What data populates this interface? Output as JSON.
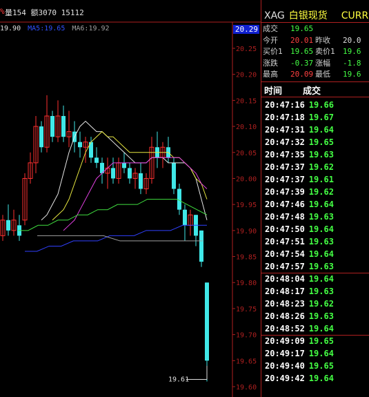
{
  "top_bar": {
    "pct_fragment": "%",
    "volume_text": "量154 额3070 15112"
  },
  "ma_line": {
    "ma1": "19.90",
    "ma2_label": "MA5:",
    "ma2": "19.65",
    "ma3_label": "MA6:",
    "ma3": "19.92"
  },
  "current_price_box": "20.29",
  "y_axis_ticks": [
    "20.25",
    "20.20",
    "20.15",
    "20.10",
    "20.05",
    "20.00",
    "19.95",
    "19.90",
    "19.85",
    "19.80",
    "19.75",
    "19.70",
    "19.65",
    "19.60"
  ],
  "low_annotation": "19.61",
  "chart_data": {
    "type": "candlestick",
    "ylim": [
      19.58,
      20.3
    ],
    "candles": [
      {
        "o": 19.89,
        "h": 19.93,
        "l": 19.88,
        "c": 19.92,
        "dir": "up"
      },
      {
        "o": 19.92,
        "h": 19.95,
        "l": 19.89,
        "c": 19.9,
        "dir": "down"
      },
      {
        "o": 19.9,
        "h": 19.94,
        "l": 19.89,
        "c": 19.92,
        "dir": "up"
      },
      {
        "o": 19.91,
        "h": 19.93,
        "l": 19.88,
        "c": 19.89,
        "dir": "down"
      },
      {
        "o": 19.92,
        "h": 20.01,
        "l": 19.91,
        "c": 20.0,
        "dir": "up"
      },
      {
        "o": 20.0,
        "h": 20.05,
        "l": 19.99,
        "c": 20.03,
        "dir": "up"
      },
      {
        "o": 20.03,
        "h": 20.12,
        "l": 20.01,
        "c": 20.1,
        "dir": "up"
      },
      {
        "o": 20.1,
        "h": 20.11,
        "l": 20.05,
        "c": 20.06,
        "dir": "down"
      },
      {
        "o": 20.06,
        "h": 20.16,
        "l": 20.05,
        "c": 20.12,
        "dir": "up"
      },
      {
        "o": 20.12,
        "h": 20.13,
        "l": 20.07,
        "c": 20.08,
        "dir": "down"
      },
      {
        "o": 20.08,
        "h": 20.15,
        "l": 20.07,
        "c": 20.12,
        "dir": "up"
      },
      {
        "o": 20.12,
        "h": 20.14,
        "l": 20.07,
        "c": 20.08,
        "dir": "down"
      },
      {
        "o": 20.08,
        "h": 20.13,
        "l": 20.06,
        "c": 20.09,
        "dir": "up"
      },
      {
        "o": 20.09,
        "h": 20.11,
        "l": 20.05,
        "c": 20.07,
        "dir": "down"
      },
      {
        "o": 20.07,
        "h": 20.09,
        "l": 20.04,
        "c": 20.06,
        "dir": "down"
      },
      {
        "o": 20.06,
        "h": 20.08,
        "l": 20.03,
        "c": 20.07,
        "dir": "up"
      },
      {
        "o": 20.07,
        "h": 20.08,
        "l": 20.03,
        "c": 20.04,
        "dir": "down"
      },
      {
        "o": 20.04,
        "h": 20.06,
        "l": 20.02,
        "c": 20.03,
        "dir": "down"
      },
      {
        "o": 20.03,
        "h": 20.04,
        "l": 19.99,
        "c": 20.01,
        "dir": "down"
      },
      {
        "o": 20.01,
        "h": 20.04,
        "l": 19.98,
        "c": 20.02,
        "dir": "up"
      },
      {
        "o": 20.02,
        "h": 20.04,
        "l": 19.99,
        "c": 20.0,
        "dir": "down"
      },
      {
        "o": 20.0,
        "h": 20.04,
        "l": 19.99,
        "c": 20.03,
        "dir": "up"
      },
      {
        "o": 20.03,
        "h": 20.05,
        "l": 20.01,
        "c": 20.02,
        "dir": "down"
      },
      {
        "o": 20.02,
        "h": 20.03,
        "l": 19.99,
        "c": 20.0,
        "dir": "down"
      },
      {
        "o": 20.0,
        "h": 20.02,
        "l": 19.98,
        "c": 20.01,
        "dir": "up"
      },
      {
        "o": 20.01,
        "h": 20.03,
        "l": 19.97,
        "c": 19.98,
        "dir": "down"
      },
      {
        "o": 19.98,
        "h": 20.01,
        "l": 19.97,
        "c": 20.0,
        "dir": "up"
      },
      {
        "o": 20.0,
        "h": 20.08,
        "l": 19.99,
        "c": 20.06,
        "dir": "up"
      },
      {
        "o": 20.06,
        "h": 20.09,
        "l": 20.02,
        "c": 20.04,
        "dir": "down"
      },
      {
        "o": 20.04,
        "h": 20.07,
        "l": 20.02,
        "c": 20.06,
        "dir": "up"
      },
      {
        "o": 20.06,
        "h": 20.08,
        "l": 20.03,
        "c": 20.04,
        "dir": "down"
      },
      {
        "o": 20.03,
        "h": 20.04,
        "l": 19.97,
        "c": 19.98,
        "dir": "down"
      },
      {
        "o": 19.98,
        "h": 19.99,
        "l": 19.93,
        "c": 19.94,
        "dir": "down"
      },
      {
        "o": 19.94,
        "h": 19.95,
        "l": 19.88,
        "c": 19.91,
        "dir": "down"
      },
      {
        "o": 19.91,
        "h": 19.94,
        "l": 19.89,
        "c": 19.93,
        "dir": "up"
      },
      {
        "o": 19.93,
        "h": 19.93,
        "l": 19.87,
        "c": 19.89,
        "dir": "down"
      },
      {
        "o": 19.9,
        "h": 19.9,
        "l": 19.83,
        "c": 19.84,
        "dir": "down"
      },
      {
        "o": 19.8,
        "h": 19.8,
        "l": 19.61,
        "c": 19.65,
        "dir": "down"
      }
    ],
    "ma_lines": [
      {
        "name": "ma-white",
        "color": "#e8e8e8",
        "points": [
          19.92,
          19.93,
          19.95,
          19.97,
          20.01,
          20.05,
          20.08,
          20.1,
          20.11,
          20.1,
          20.09,
          20.09,
          20.08,
          20.07,
          20.06,
          20.05,
          20.04,
          20.03,
          20.03,
          20.03,
          20.04,
          20.04,
          20.04,
          20.03,
          20.03,
          20.03,
          20.03,
          20.02,
          20.0,
          19.96,
          19.92
        ]
      },
      {
        "name": "ma-yellow",
        "color": "#e8e840",
        "points": [
          19.92,
          19.93,
          19.94,
          19.96,
          19.99,
          20.02,
          20.05,
          20.07,
          20.08,
          20.09,
          20.08,
          20.08,
          20.07,
          20.06,
          20.05,
          20.05,
          20.05,
          20.05,
          20.05,
          20.05,
          20.05,
          20.05,
          20.04,
          20.04,
          20.03,
          20.02,
          20.0,
          19.99,
          19.96
        ]
      },
      {
        "name": "ma-magenta",
        "color": "#e040e0",
        "points": [
          19.9,
          19.91,
          19.92,
          19.94,
          19.96,
          19.98,
          20.0,
          20.01,
          20.02,
          20.03,
          20.03,
          20.03,
          20.03,
          20.03,
          20.03,
          20.03,
          20.04,
          20.04,
          20.04,
          20.04,
          20.04,
          20.04,
          20.03,
          20.02,
          20.01,
          19.99,
          19.98
        ]
      },
      {
        "name": "ma-green",
        "color": "#40e040",
        "points": [
          19.9,
          19.9,
          19.91,
          19.91,
          19.92,
          19.92,
          19.93,
          19.93,
          19.94,
          19.94,
          19.95,
          19.95,
          19.95,
          19.96,
          19.96,
          19.96,
          19.96,
          19.95,
          19.94,
          19.93
        ]
      },
      {
        "name": "ma-blue",
        "color": "#3040ff",
        "points": [
          19.86,
          19.86,
          19.87,
          19.87,
          19.88,
          19.88,
          19.88,
          19.89,
          19.89,
          19.89,
          19.9,
          19.9,
          19.9,
          19.91,
          19.91,
          19.91
        ]
      },
      {
        "name": "ma-gray",
        "color": "#a0a0a0",
        "points": [
          19.89,
          19.89,
          19.89,
          19.89,
          19.89,
          19.88,
          19.88,
          19.88,
          19.88,
          19.88,
          19.88
        ]
      }
    ]
  },
  "quote": {
    "symbol": "XAG",
    "name": "白银现货",
    "currency": "CURR",
    "rows": [
      {
        "l1": "成交",
        "v1": "19.65",
        "c1": "green",
        "l2": "",
        "v2": "",
        "c2": "white"
      },
      {
        "l1": "今开",
        "v1": "20.01",
        "c1": "red",
        "l2": "昨收",
        "v2": "20.0",
        "c2": "white"
      },
      {
        "l1": "买价1",
        "v1": "19.65",
        "c1": "green",
        "l2": "卖价1",
        "v2": "19.6",
        "c2": "green"
      },
      {
        "l1": "涨跌",
        "v1": "-0.37",
        "c1": "green",
        "l2": "涨幅",
        "v2": "-1.8",
        "c2": "green"
      },
      {
        "l1": "最高",
        "v1": "20.09",
        "c1": "red",
        "l2": "最低",
        "v2": "19.6",
        "c2": "green"
      }
    ]
  },
  "trades": {
    "header_time": "时间",
    "header_price": "成交",
    "rows": [
      {
        "time": "20:47:16",
        "price": "19.66"
      },
      {
        "time": "20:47:18",
        "price": "19.67"
      },
      {
        "time": "20:47:31",
        "price": "19.64"
      },
      {
        "time": "20:47:32",
        "price": "19.65"
      },
      {
        "time": "20:47:35",
        "price": "19.63"
      },
      {
        "time": "20:47:37",
        "price": "19.62"
      },
      {
        "time": "20:47:37",
        "price": "19.61"
      },
      {
        "time": "20:47:39",
        "price": "19.62"
      },
      {
        "time": "20:47:46",
        "price": "19.64"
      },
      {
        "time": "20:47:48",
        "price": "19.63"
      },
      {
        "time": "20:47:50",
        "price": "19.64"
      },
      {
        "time": "20:47:51",
        "price": "19.63"
      },
      {
        "time": "20:47:54",
        "price": "19.64"
      },
      {
        "time": "20:47:57",
        "price": "19.63"
      },
      {
        "time": "20:48:04",
        "price": "19.64"
      },
      {
        "time": "20:48:17",
        "price": "19.63"
      },
      {
        "time": "20:48:23",
        "price": "19.62"
      },
      {
        "time": "20:48:26",
        "price": "19.63"
      },
      {
        "time": "20:48:52",
        "price": "19.64"
      },
      {
        "time": "20:49:09",
        "price": "19.65"
      },
      {
        "time": "20:49:17",
        "price": "19.64"
      },
      {
        "time": "20:49:40",
        "price": "19.65"
      },
      {
        "time": "20:49:42",
        "price": "19.64"
      }
    ]
  }
}
